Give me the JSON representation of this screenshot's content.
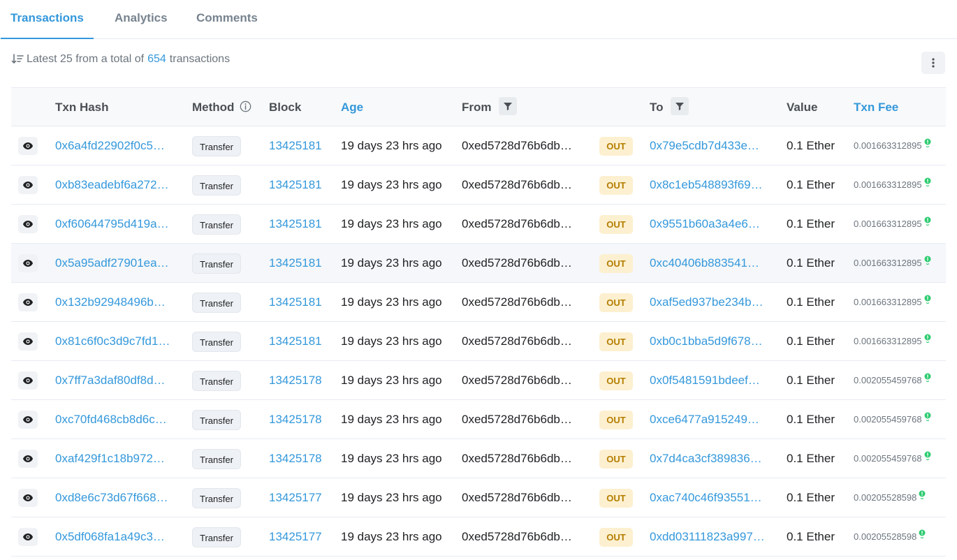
{
  "tabs": [
    {
      "label": "Transactions",
      "active": true
    },
    {
      "label": "Analytics",
      "active": false
    },
    {
      "label": "Comments",
      "active": false
    }
  ],
  "summary": {
    "prefix": "Latest 25 from a total of",
    "count": "654",
    "suffix": "transactions"
  },
  "columns": {
    "hash": "Txn Hash",
    "method": "Method",
    "block": "Block",
    "age": "Age",
    "from": "From",
    "to": "To",
    "value": "Value",
    "fee": "Txn Fee"
  },
  "rows": [
    {
      "hash": "0x6a4fd22902f0c5…",
      "method": "Transfer",
      "block": "13425181",
      "age": "19 days 23 hrs ago",
      "from": "0xed5728d76b6db…",
      "direction": "OUT",
      "to": "0x79e5cdb7d433e…",
      "value": "0.1 Ether",
      "fee": "0.001663312895"
    },
    {
      "hash": "0xb83eadebf6a272…",
      "method": "Transfer",
      "block": "13425181",
      "age": "19 days 23 hrs ago",
      "from": "0xed5728d76b6db…",
      "direction": "OUT",
      "to": "0x8c1eb548893f69…",
      "value": "0.1 Ether",
      "fee": "0.001663312895"
    },
    {
      "hash": "0xf60644795d419a…",
      "method": "Transfer",
      "block": "13425181",
      "age": "19 days 23 hrs ago",
      "from": "0xed5728d76b6db…",
      "direction": "OUT",
      "to": "0x9551b60a3a4e6…",
      "value": "0.1 Ether",
      "fee": "0.001663312895"
    },
    {
      "hash": "0x5a95adf27901ea…",
      "method": "Transfer",
      "block": "13425181",
      "age": "19 days 23 hrs ago",
      "from": "0xed5728d76b6db…",
      "direction": "OUT",
      "to": "0xc40406b883541…",
      "value": "0.1 Ether",
      "fee": "0.001663312895"
    },
    {
      "hash": "0x132b92948496b…",
      "method": "Transfer",
      "block": "13425181",
      "age": "19 days 23 hrs ago",
      "from": "0xed5728d76b6db…",
      "direction": "OUT",
      "to": "0xaf5ed937be234b…",
      "value": "0.1 Ether",
      "fee": "0.001663312895"
    },
    {
      "hash": "0x81c6f0c3d9c7fd1…",
      "method": "Transfer",
      "block": "13425181",
      "age": "19 days 23 hrs ago",
      "from": "0xed5728d76b6db…",
      "direction": "OUT",
      "to": "0xb0c1bba5d9f678…",
      "value": "0.1 Ether",
      "fee": "0.001663312895"
    },
    {
      "hash": "0x7ff7a3daf80df8d…",
      "method": "Transfer",
      "block": "13425178",
      "age": "19 days 23 hrs ago",
      "from": "0xed5728d76b6db…",
      "direction": "OUT",
      "to": "0x0f5481591bdeef…",
      "value": "0.1 Ether",
      "fee": "0.002055459768"
    },
    {
      "hash": "0xc70fd468cb8d6c…",
      "method": "Transfer",
      "block": "13425178",
      "age": "19 days 23 hrs ago",
      "from": "0xed5728d76b6db…",
      "direction": "OUT",
      "to": "0xce6477a915249…",
      "value": "0.1 Ether",
      "fee": "0.002055459768"
    },
    {
      "hash": "0xaf429f1c18b972…",
      "method": "Transfer",
      "block": "13425178",
      "age": "19 days 23 hrs ago",
      "from": "0xed5728d76b6db…",
      "direction": "OUT",
      "to": "0x7d4ca3cf389836…",
      "value": "0.1 Ether",
      "fee": "0.002055459768"
    },
    {
      "hash": "0xd8e6c73d67f668…",
      "method": "Transfer",
      "block": "13425177",
      "age": "19 days 23 hrs ago",
      "from": "0xed5728d76b6db…",
      "direction": "OUT",
      "to": "0xac740c46f93551…",
      "value": "0.1 Ether",
      "fee": "0.00205528598"
    },
    {
      "hash": "0x5df068fa1a49c3…",
      "method": "Transfer",
      "block": "13425177",
      "age": "19 days 23 hrs ago",
      "from": "0xed5728d76b6db…",
      "direction": "OUT",
      "to": "0xdd03111823a997…",
      "value": "0.1 Ether",
      "fee": "0.00205528598"
    }
  ],
  "colors": {
    "link": "#3498db",
    "out_badge_bg": "#fdf0d0",
    "out_badge_text": "#b47d00",
    "fee_indicator": "#2ecc71"
  },
  "icons": {
    "sort": "sort-descending-icon",
    "more": "vertical-dots-icon",
    "info": "info-circle-icon",
    "filter": "filter-funnel-icon",
    "eye": "eye-icon",
    "fee": "green-dot-icon"
  }
}
